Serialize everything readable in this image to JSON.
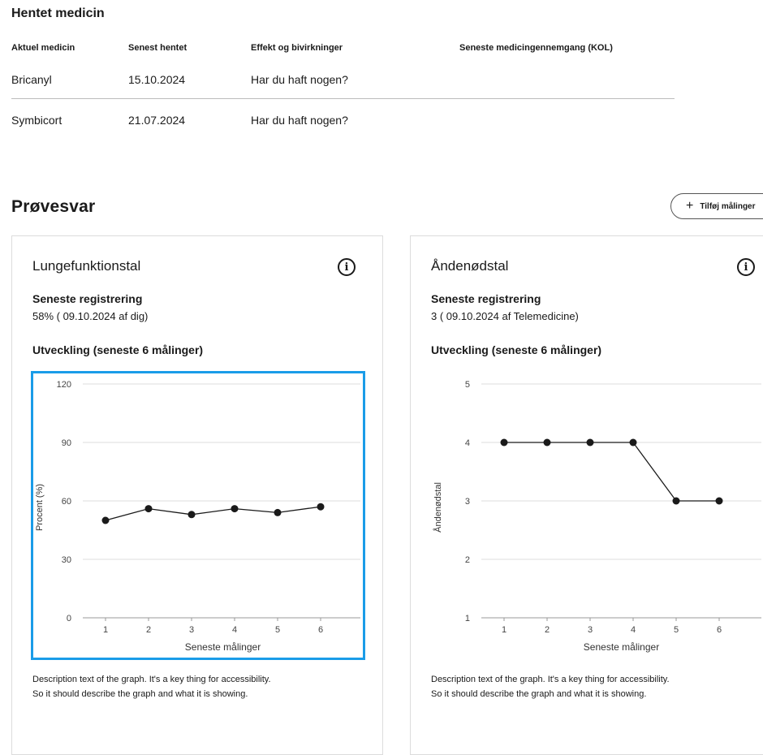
{
  "medicine": {
    "title": "Hentet medicin",
    "columns": [
      "Aktuel medicin",
      "Senest hentet",
      "Effekt og bivirkninger",
      "Seneste medicingennemgang (KOL)"
    ],
    "rows": [
      {
        "name": "Bricanyl",
        "date": "15.10.2024",
        "effect": "Har du haft nogen?"
      },
      {
        "name": "Symbicort",
        "date": "21.07.2024",
        "effect": "Har du haft nogen?"
      }
    ]
  },
  "results": {
    "title": "Prøvesvar",
    "add_button_label": "Tilføj målinger",
    "add_button_icon": "plus-icon"
  },
  "cards": [
    {
      "title": "Lungefunktionstal",
      "latest_label": "Seneste registrering",
      "latest_value": "58% ( 09.10.2024 af dig)",
      "trend_label": "Utveckling (seneste 6 målinger)",
      "description_line1": "Description text of the graph. It's a key thing for accessibility.",
      "description_line2": "So it should describe the graph and what it is showing.",
      "focused": true
    },
    {
      "title": "Åndenødstal",
      "latest_label": "Seneste registrering",
      "latest_value": "3 ( 09.10.2024 af Telemedicine)",
      "trend_label": "Utveckling (seneste 6 målinger)",
      "description_line1": "Description text of the graph. It's a key thing for accessibility.",
      "description_line2": "So it should describe the graph and what it is showing.",
      "focused": false
    }
  ],
  "chart_data": [
    {
      "type": "line",
      "x": [
        1,
        2,
        3,
        4,
        5,
        6
      ],
      "values": [
        50,
        56,
        53,
        56,
        54,
        57
      ],
      "ylim": [
        0,
        120
      ],
      "yticks": [
        0,
        30,
        60,
        90,
        120
      ],
      "xlabel": "Seneste målinger",
      "ylabel": "Procent (%)",
      "grid": true
    },
    {
      "type": "line",
      "x": [
        1,
        2,
        3,
        4,
        5,
        6
      ],
      "values": [
        4,
        4,
        4,
        4,
        3,
        3
      ],
      "ylim": [
        1,
        5
      ],
      "yticks": [
        1,
        2,
        3,
        4,
        5
      ],
      "xlabel": "Seneste målinger",
      "ylabel": "Åndenødstal",
      "grid": true
    }
  ],
  "colors": {
    "focus_outline": "#1a9ce8",
    "line": "#1a1a1a",
    "grid": "#dedede",
    "divider": "#bdbdbd"
  }
}
